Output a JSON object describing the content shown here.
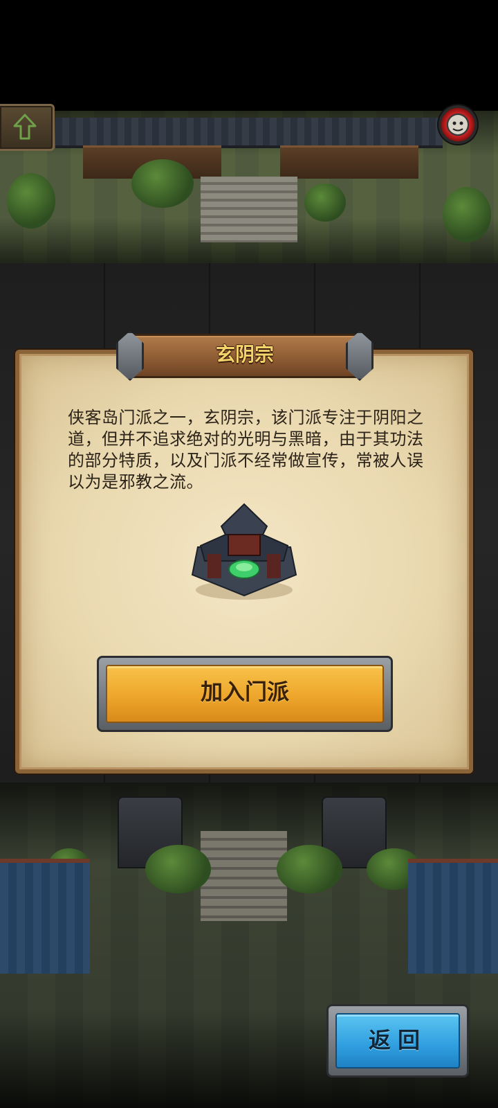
{
  "header": {
    "up_button_icon": "up-arrow-icon",
    "avatar_icon": "player-avatar-icon"
  },
  "sect_panel": {
    "title": "玄阴宗",
    "description": "侠客岛门派之一，玄阴宗，该门派专注于阴阳之道，但并不追求绝对的光明与黑暗，由于其功法的部分特质，以及门派不经常做宣传，常被人误以为是邪教之流。",
    "building_icon": "sect-building-icon",
    "join_button_label": "加入门派"
  },
  "footer": {
    "back_button_label": "返回"
  },
  "colors": {
    "join_button": "#eea62c",
    "back_button": "#2f9ee0",
    "title_text": "#f3d36a",
    "parchment": "#ead9b0"
  }
}
